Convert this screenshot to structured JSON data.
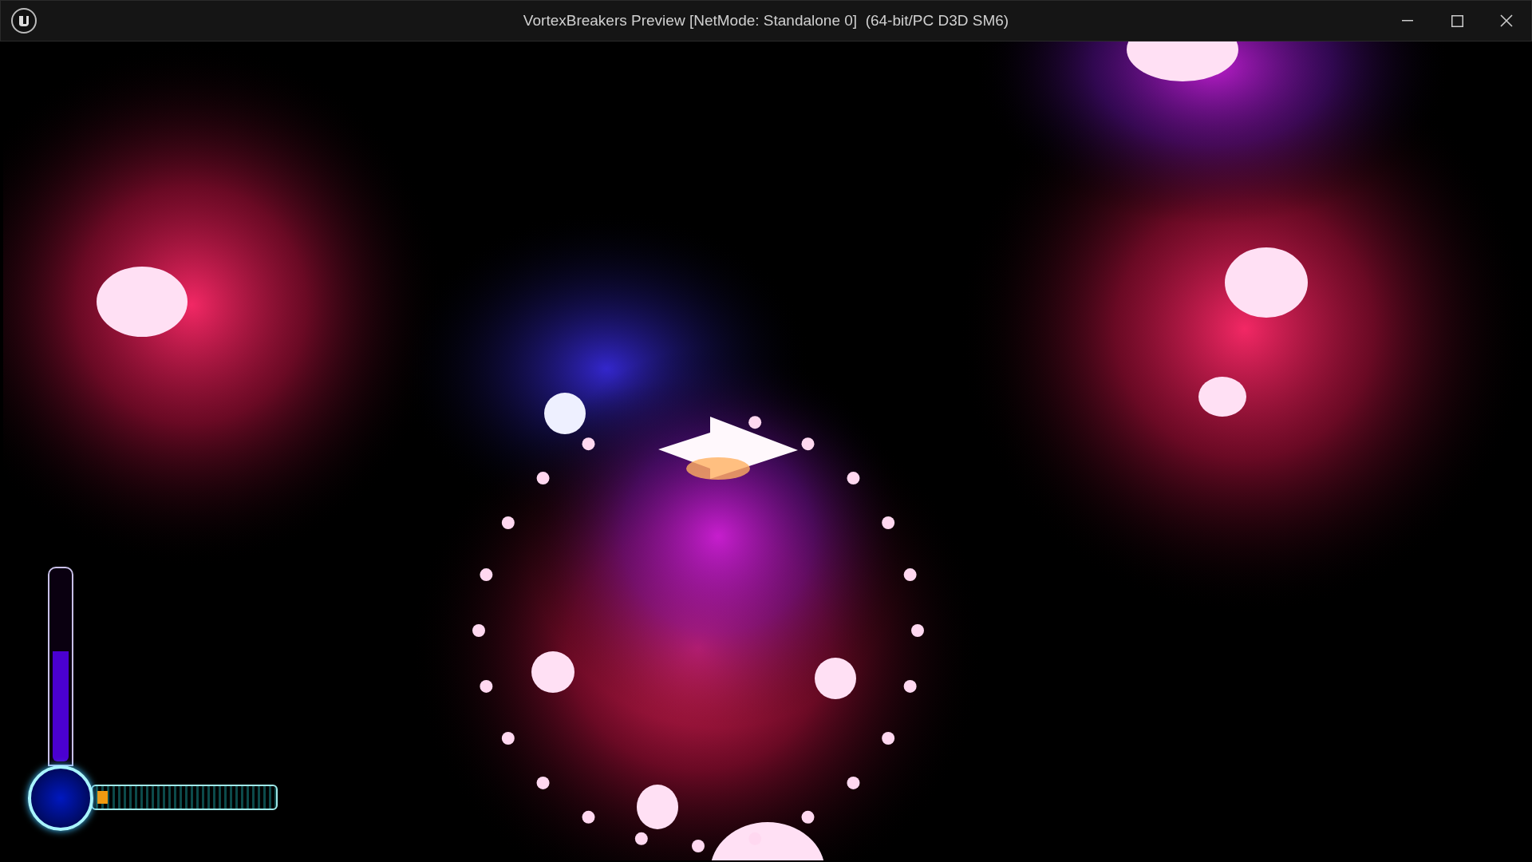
{
  "window": {
    "title": "VortexBreakers Preview [NetMode: Standalone 0]  (64-bit/PC D3D SM6)"
  },
  "hud": {
    "energy_bar": {
      "level": 0.58
    },
    "progress_bar": {
      "level": 0.06
    }
  }
}
